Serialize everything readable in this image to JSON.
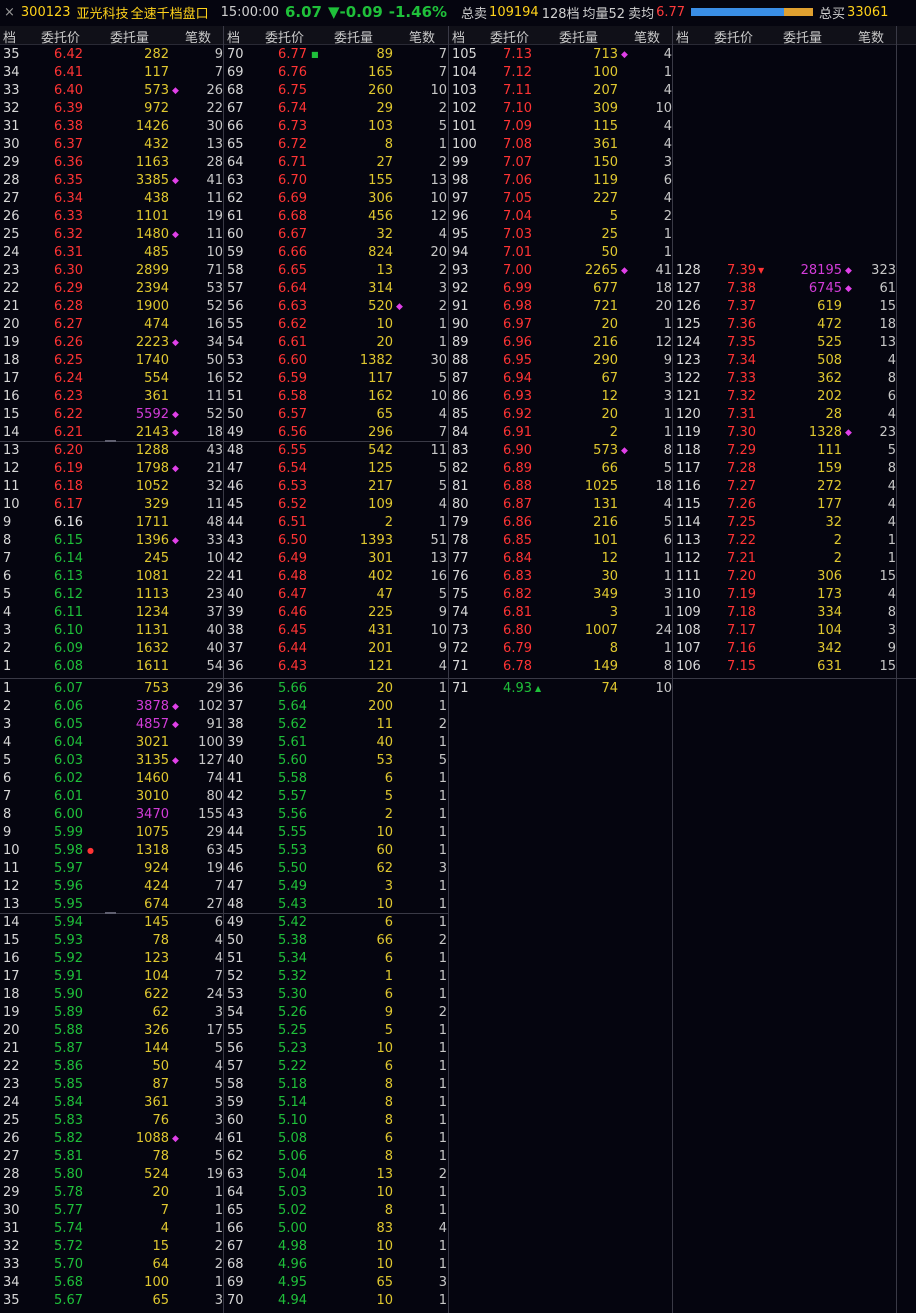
{
  "titlebar": {
    "close": "×",
    "code": "300123",
    "name": "亚光科技",
    "title": "全速千档盘口",
    "time": "15:00:00",
    "price": "6.07",
    "change": "▼-0.09",
    "change_pct": "-1.46%",
    "total_sell_label": "总卖",
    "total_sell": "109194",
    "levels": "128档",
    "avg_qty_label": "均量52",
    "sell_avg_label": "卖均",
    "sell_avg": "6.77",
    "total_buy_label": "总买",
    "total_buy": "33061",
    "buy_ratio": 0.76
  },
  "columns": [
    "档",
    "委托价",
    "委托量",
    "笔数"
  ],
  "colors": {
    "up": "#ff3434",
    "down": "#1fc03a",
    "flat": "#e6e6e6",
    "volume": "#e0c830",
    "big_order": "#d23cd8"
  },
  "ask_blocks": [
    [
      [
        "35",
        "6.42",
        "282",
        "9"
      ],
      [
        "34",
        "6.41",
        "117",
        "7"
      ],
      [
        "33",
        "6.40",
        "573",
        "26"
      ],
      [
        "32",
        "6.39",
        "972",
        "22"
      ],
      [
        "31",
        "6.38",
        "1426",
        "30"
      ],
      [
        "30",
        "6.37",
        "432",
        "13"
      ],
      [
        "29",
        "6.36",
        "1163",
        "28"
      ],
      [
        "28",
        "6.35",
        "3385",
        "41"
      ],
      [
        "27",
        "6.34",
        "438",
        "11"
      ],
      [
        "26",
        "6.33",
        "1101",
        "19"
      ],
      [
        "25",
        "6.32",
        "1480",
        "11"
      ],
      [
        "24",
        "6.31",
        "485",
        "10"
      ],
      [
        "23",
        "6.30",
        "2899",
        "71"
      ],
      [
        "22",
        "6.29",
        "2394",
        "53"
      ],
      [
        "21",
        "6.28",
        "1900",
        "52"
      ],
      [
        "20",
        "6.27",
        "474",
        "16"
      ],
      [
        "19",
        "6.26",
        "2223",
        "34"
      ],
      [
        "18",
        "6.25",
        "1740",
        "50"
      ],
      [
        "17",
        "6.24",
        "554",
        "16"
      ],
      [
        "16",
        "6.23",
        "361",
        "11"
      ],
      [
        "15",
        "6.22",
        "5592",
        "52"
      ],
      [
        "14",
        "6.21",
        "2143",
        "18"
      ],
      [
        "13",
        "6.20",
        "1288",
        "43"
      ],
      [
        "12",
        "6.19",
        "1798",
        "21"
      ],
      [
        "11",
        "6.18",
        "1052",
        "32"
      ],
      [
        "10",
        "6.17",
        "329",
        "11"
      ],
      [
        "9",
        "6.16",
        "1711",
        "48"
      ],
      [
        "8",
        "6.15",
        "1396",
        "33"
      ],
      [
        "7",
        "6.14",
        "245",
        "10"
      ],
      [
        "6",
        "6.13",
        "1081",
        "22"
      ],
      [
        "5",
        "6.12",
        "1113",
        "23"
      ],
      [
        "4",
        "6.11",
        "1234",
        "37"
      ],
      [
        "3",
        "6.10",
        "1131",
        "40"
      ],
      [
        "2",
        "6.09",
        "1632",
        "40"
      ],
      [
        "1",
        "6.08",
        "1611",
        "54"
      ]
    ],
    [
      [
        "70",
        "6.77",
        "89",
        "7"
      ],
      [
        "69",
        "6.76",
        "165",
        "7"
      ],
      [
        "68",
        "6.75",
        "260",
        "10"
      ],
      [
        "67",
        "6.74",
        "29",
        "2"
      ],
      [
        "66",
        "6.73",
        "103",
        "5"
      ],
      [
        "65",
        "6.72",
        "8",
        "1"
      ],
      [
        "64",
        "6.71",
        "27",
        "2"
      ],
      [
        "63",
        "6.70",
        "155",
        "13"
      ],
      [
        "62",
        "6.69",
        "306",
        "10"
      ],
      [
        "61",
        "6.68",
        "456",
        "12"
      ],
      [
        "60",
        "6.67",
        "32",
        "4"
      ],
      [
        "59",
        "6.66",
        "824",
        "20"
      ],
      [
        "58",
        "6.65",
        "13",
        "2"
      ],
      [
        "57",
        "6.64",
        "314",
        "3"
      ],
      [
        "56",
        "6.63",
        "520",
        "2"
      ],
      [
        "55",
        "6.62",
        "10",
        "1"
      ],
      [
        "54",
        "6.61",
        "20",
        "1"
      ],
      [
        "53",
        "6.60",
        "1382",
        "30"
      ],
      [
        "52",
        "6.59",
        "117",
        "5"
      ],
      [
        "51",
        "6.58",
        "162",
        "10"
      ],
      [
        "50",
        "6.57",
        "65",
        "4"
      ],
      [
        "49",
        "6.56",
        "296",
        "7"
      ],
      [
        "48",
        "6.55",
        "542",
        "11"
      ],
      [
        "47",
        "6.54",
        "125",
        "5"
      ],
      [
        "46",
        "6.53",
        "217",
        "5"
      ],
      [
        "45",
        "6.52",
        "109",
        "4"
      ],
      [
        "44",
        "6.51",
        "2",
        "1"
      ],
      [
        "43",
        "6.50",
        "1393",
        "51"
      ],
      [
        "42",
        "6.49",
        "301",
        "13"
      ],
      [
        "41",
        "6.48",
        "402",
        "16"
      ],
      [
        "40",
        "6.47",
        "47",
        "5"
      ],
      [
        "39",
        "6.46",
        "225",
        "9"
      ],
      [
        "38",
        "6.45",
        "431",
        "10"
      ],
      [
        "37",
        "6.44",
        "201",
        "9"
      ],
      [
        "36",
        "6.43",
        "121",
        "4"
      ]
    ],
    [
      [
        "105",
        "7.13",
        "713",
        "4"
      ],
      [
        "104",
        "7.12",
        "100",
        "1"
      ],
      [
        "103",
        "7.11",
        "207",
        "4"
      ],
      [
        "102",
        "7.10",
        "309",
        "10"
      ],
      [
        "101",
        "7.09",
        "115",
        "4"
      ],
      [
        "100",
        "7.08",
        "361",
        "4"
      ],
      [
        "99",
        "7.07",
        "150",
        "3"
      ],
      [
        "98",
        "7.06",
        "119",
        "6"
      ],
      [
        "97",
        "7.05",
        "227",
        "4"
      ],
      [
        "96",
        "7.04",
        "5",
        "2"
      ],
      [
        "95",
        "7.03",
        "25",
        "1"
      ],
      [
        "94",
        "7.01",
        "50",
        "1"
      ],
      [
        "93",
        "7.00",
        "2265",
        "41"
      ],
      [
        "92",
        "6.99",
        "677",
        "18"
      ],
      [
        "91",
        "6.98",
        "721",
        "20"
      ],
      [
        "90",
        "6.97",
        "20",
        "1"
      ],
      [
        "89",
        "6.96",
        "216",
        "12"
      ],
      [
        "88",
        "6.95",
        "290",
        "9"
      ],
      [
        "87",
        "6.94",
        "67",
        "3"
      ],
      [
        "86",
        "6.93",
        "12",
        "3"
      ],
      [
        "85",
        "6.92",
        "20",
        "1"
      ],
      [
        "84",
        "6.91",
        "2",
        "1"
      ],
      [
        "83",
        "6.90",
        "573",
        "8"
      ],
      [
        "82",
        "6.89",
        "66",
        "5"
      ],
      [
        "81",
        "6.88",
        "1025",
        "18"
      ],
      [
        "80",
        "6.87",
        "131",
        "4"
      ],
      [
        "79",
        "6.86",
        "216",
        "5"
      ],
      [
        "78",
        "6.85",
        "101",
        "6"
      ],
      [
        "77",
        "6.84",
        "12",
        "1"
      ],
      [
        "76",
        "6.83",
        "30",
        "1"
      ],
      [
        "75",
        "6.82",
        "349",
        "3"
      ],
      [
        "74",
        "6.81",
        "3",
        "1"
      ],
      [
        "73",
        "6.80",
        "1007",
        "24"
      ],
      [
        "72",
        "6.79",
        "8",
        "1"
      ],
      [
        "71",
        "6.78",
        "149",
        "8"
      ]
    ],
    [
      [
        "128",
        "7.39",
        "28195",
        "323"
      ],
      [
        "127",
        "7.38",
        "6745",
        "61"
      ],
      [
        "126",
        "7.37",
        "619",
        "15"
      ],
      [
        "125",
        "7.36",
        "472",
        "18"
      ],
      [
        "124",
        "7.35",
        "525",
        "13"
      ],
      [
        "123",
        "7.34",
        "508",
        "4"
      ],
      [
        "122",
        "7.33",
        "362",
        "8"
      ],
      [
        "121",
        "7.32",
        "202",
        "6"
      ],
      [
        "120",
        "7.31",
        "28",
        "4"
      ],
      [
        "119",
        "7.30",
        "1328",
        "23"
      ],
      [
        "118",
        "7.29",
        "111",
        "5"
      ],
      [
        "117",
        "7.28",
        "159",
        "8"
      ],
      [
        "116",
        "7.27",
        "272",
        "4"
      ],
      [
        "115",
        "7.26",
        "177",
        "4"
      ],
      [
        "114",
        "7.25",
        "32",
        "4"
      ],
      [
        "113",
        "7.22",
        "2",
        "1"
      ],
      [
        "112",
        "7.21",
        "2",
        "1"
      ],
      [
        "111",
        "7.20",
        "306",
        "15"
      ],
      [
        "110",
        "7.19",
        "173",
        "4"
      ],
      [
        "109",
        "7.18",
        "334",
        "8"
      ],
      [
        "108",
        "7.17",
        "104",
        "3"
      ],
      [
        "107",
        "7.16",
        "342",
        "9"
      ],
      [
        "106",
        "7.15",
        "631",
        "15"
      ]
    ]
  ],
  "bid_blocks": [
    [
      [
        "1",
        "6.07",
        "753",
        "29"
      ],
      [
        "2",
        "6.06",
        "3878",
        "102"
      ],
      [
        "3",
        "6.05",
        "4857",
        "91"
      ],
      [
        "4",
        "6.04",
        "3021",
        "100"
      ],
      [
        "5",
        "6.03",
        "3135",
        "127"
      ],
      [
        "6",
        "6.02",
        "1460",
        "74"
      ],
      [
        "7",
        "6.01",
        "3010",
        "80"
      ],
      [
        "8",
        "6.00",
        "3470",
        "155"
      ],
      [
        "9",
        "5.99",
        "1075",
        "29"
      ],
      [
        "10",
        "5.98",
        "1318",
        "63"
      ],
      [
        "11",
        "5.97",
        "924",
        "19"
      ],
      [
        "12",
        "5.96",
        "424",
        "7"
      ],
      [
        "13",
        "5.95",
        "674",
        "27"
      ],
      [
        "14",
        "5.94",
        "145",
        "6"
      ],
      [
        "15",
        "5.93",
        "78",
        "4"
      ],
      [
        "16",
        "5.92",
        "123",
        "4"
      ],
      [
        "17",
        "5.91",
        "104",
        "7"
      ],
      [
        "18",
        "5.90",
        "622",
        "24"
      ],
      [
        "19",
        "5.89",
        "62",
        "3"
      ],
      [
        "20",
        "5.88",
        "326",
        "17"
      ],
      [
        "21",
        "5.87",
        "144",
        "5"
      ],
      [
        "22",
        "5.86",
        "50",
        "4"
      ],
      [
        "23",
        "5.85",
        "87",
        "5"
      ],
      [
        "24",
        "5.84",
        "361",
        "3"
      ],
      [
        "25",
        "5.83",
        "76",
        "3"
      ],
      [
        "26",
        "5.82",
        "1088",
        "4"
      ],
      [
        "27",
        "5.81",
        "78",
        "5"
      ],
      [
        "28",
        "5.80",
        "524",
        "19"
      ],
      [
        "29",
        "5.78",
        "20",
        "1"
      ],
      [
        "30",
        "5.77",
        "7",
        "1"
      ],
      [
        "31",
        "5.74",
        "4",
        "1"
      ],
      [
        "32",
        "5.72",
        "15",
        "2"
      ],
      [
        "33",
        "5.70",
        "64",
        "2"
      ],
      [
        "34",
        "5.68",
        "100",
        "1"
      ],
      [
        "35",
        "5.67",
        "65",
        "3"
      ]
    ],
    [
      [
        "36",
        "5.66",
        "20",
        "1"
      ],
      [
        "37",
        "5.64",
        "200",
        "1"
      ],
      [
        "38",
        "5.62",
        "11",
        "2"
      ],
      [
        "39",
        "5.61",
        "40",
        "1"
      ],
      [
        "40",
        "5.60",
        "53",
        "5"
      ],
      [
        "41",
        "5.58",
        "6",
        "1"
      ],
      [
        "42",
        "5.57",
        "5",
        "1"
      ],
      [
        "43",
        "5.56",
        "2",
        "1"
      ],
      [
        "44",
        "5.55",
        "10",
        "1"
      ],
      [
        "45",
        "5.53",
        "60",
        "1"
      ],
      [
        "46",
        "5.50",
        "62",
        "3"
      ],
      [
        "47",
        "5.49",
        "3",
        "1"
      ],
      [
        "48",
        "5.43",
        "10",
        "1"
      ],
      [
        "49",
        "5.42",
        "6",
        "1"
      ],
      [
        "50",
        "5.38",
        "66",
        "2"
      ],
      [
        "51",
        "5.34",
        "6",
        "1"
      ],
      [
        "52",
        "5.32",
        "1",
        "1"
      ],
      [
        "53",
        "5.30",
        "6",
        "1"
      ],
      [
        "54",
        "5.26",
        "9",
        "2"
      ],
      [
        "55",
        "5.25",
        "5",
        "1"
      ],
      [
        "56",
        "5.23",
        "10",
        "1"
      ],
      [
        "57",
        "5.22",
        "6",
        "1"
      ],
      [
        "58",
        "5.18",
        "8",
        "1"
      ],
      [
        "59",
        "5.14",
        "8",
        "1"
      ],
      [
        "60",
        "5.10",
        "8",
        "1"
      ],
      [
        "61",
        "5.08",
        "6",
        "1"
      ],
      [
        "62",
        "5.06",
        "8",
        "1"
      ],
      [
        "63",
        "5.04",
        "13",
        "2"
      ],
      [
        "64",
        "5.03",
        "10",
        "1"
      ],
      [
        "65",
        "5.02",
        "8",
        "1"
      ],
      [
        "66",
        "5.00",
        "83",
        "4"
      ],
      [
        "67",
        "4.98",
        "10",
        "1"
      ],
      [
        "68",
        "4.96",
        "10",
        "1"
      ],
      [
        "69",
        "4.95",
        "65",
        "3"
      ],
      [
        "70",
        "4.94",
        "10",
        "1"
      ]
    ],
    [
      [
        "71",
        "4.93",
        "74",
        "10"
      ]
    ]
  ],
  "big_order_volumes": [
    "5592",
    "3878",
    "4857",
    "3470",
    "28195",
    "6745"
  ],
  "diamond_marked": {
    "ask": [
      "3385",
      "1480",
      "2223",
      "5592",
      "2143",
      "1798",
      "1396",
      "520",
      "713",
      "2265",
      "573",
      "28195",
      "6745",
      "1328"
    ],
    "bid": [
      "3878",
      "4857",
      "3135",
      "1088"
    ]
  }
}
